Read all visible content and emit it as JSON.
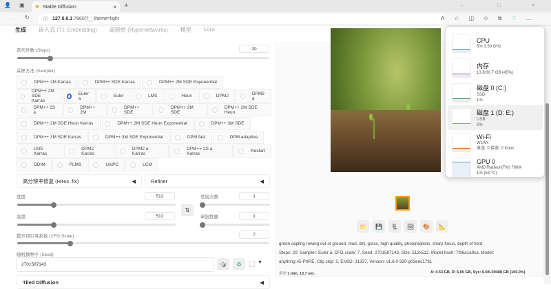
{
  "browser": {
    "tab_title": "Stable Diffusion",
    "url_host": "127.0.0.1",
    "url_rest": ":7860/?__theme=light"
  },
  "tabs": [
    "生成",
    "嵌入式 (T.I. Embedding)",
    "超网络 (Hypernetworks)",
    "模型",
    "Lora"
  ],
  "steps": {
    "label": "迭代步数 (Steps)",
    "value": "20",
    "fraction": 0.13
  },
  "sampler": {
    "label": "采样方法 (Sampler)",
    "selected": "Euler a",
    "options": [
      "DPM++ 2M Karras",
      "DPM++ SDE Karras",
      "DPM++ 2M SDE Exponential",
      "DPM++ 2M SDE Karras",
      "Euler a",
      "Euler",
      "LMS",
      "Heun",
      "DPM2",
      "DPM2 a",
      "DPM++ 2S a",
      "DPM++ 2M",
      "DPM++ SDE",
      "DPM++ 2M SDE",
      "DPM++ 2M SDE Heun",
      "DPM++ 2M SDE Heun Karras",
      "DPM++ 2M SDE Heun Exponential",
      "DPM++ 3M SDE",
      "DPM++ 3M SDE Karras",
      "DPM++ 3M SDE Exponential",
      "DPM fast",
      "DPM adaptive",
      "LMS Karras",
      "DPM2 Karras",
      "DPM2 a Karras",
      "DPM++ 2S a Karras",
      "Restart",
      "DDIM",
      "PLMS",
      "UniPC",
      "LCM"
    ]
  },
  "hires": "高分辨率修复 (Hires. fix)",
  "refiner": "Refiner",
  "width": {
    "label": "宽度",
    "value": "512"
  },
  "height": {
    "label": "高度",
    "value": "512"
  },
  "batch_count": {
    "label": "总批次数",
    "value": "1"
  },
  "batch_size": {
    "label": "单批数量",
    "value": "1"
  },
  "cfg": {
    "label": "提示词引导系数 (CFG Scale)",
    "value": "7"
  },
  "seed": {
    "label": "随机数种子 (Seed)",
    "value": "2701587143"
  },
  "tiled": "Tiled Diffusion",
  "output": {
    "prompt": "green sapling rowing out of ground, mud, dirt, grass, high quality, photorealistic, sharp focus, depth of field",
    "params1": "Steps: 20, Sampler: Euler a, CFG scale: 7, Seed: 2701587143, Size: 512x512, Model hash: 7f96a1a9ca, Model:",
    "params2": "anything-v5-PrtRE, Clip skip: 2, ENSD: 31337, Version: v1.6.0-320-g03eec1791",
    "time_label": "用时:",
    "time": "1 min. 13.7 sec.",
    "mem": "A: 0.53 GB, R: 6.00 GB, Sys: 6.0/6.00488 GB (100.0%)"
  },
  "perf": [
    {
      "title": "CPU",
      "sub1": "5% 3.39 GHz",
      "sub2": ""
    },
    {
      "title": "内存",
      "sub1": "13.8/30.7 GB (45%)",
      "sub2": ""
    },
    {
      "title": "磁盘 0 (C:)",
      "sub1": "SSD",
      "sub2": "1%"
    },
    {
      "title": "磁盘 1 (D: E:)",
      "sub1": "USB",
      "sub2": "0%"
    },
    {
      "title": "Wi-Fi",
      "sub1": "WLAN",
      "sub2": "发送: 0 接收: 0 Kbps"
    },
    {
      "title": "GPU 0",
      "sub1": "AMD Radeon(TM) 780M",
      "sub2": "1% (53 °C)"
    }
  ]
}
